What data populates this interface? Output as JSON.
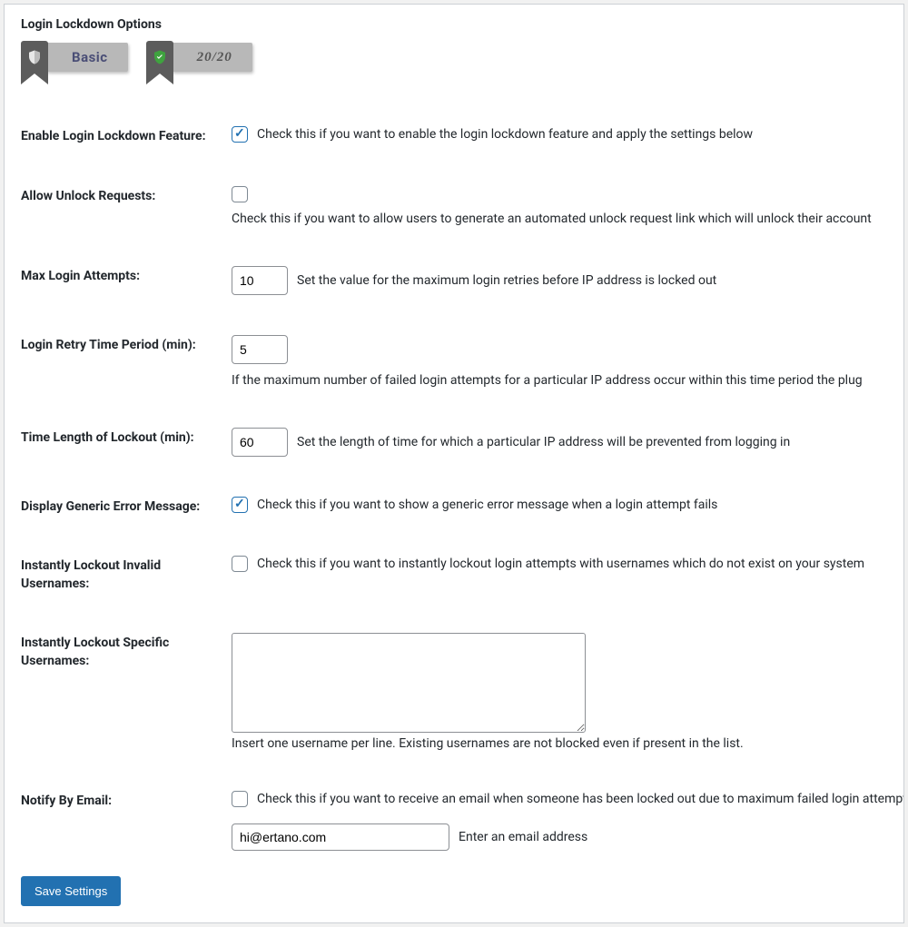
{
  "panel": {
    "title": "Login Lockdown Options"
  },
  "badges": {
    "basic_label": "Basic",
    "score_label": "20/20"
  },
  "fields": {
    "enable": {
      "label": "Enable Login Lockdown Feature:",
      "checked": true,
      "desc": "Check this if you want to enable the login lockdown feature and apply the settings below"
    },
    "allow_unlock": {
      "label": "Allow Unlock Requests:",
      "checked": false,
      "desc": "Check this if you want to allow users to generate an automated unlock request link which will unlock their account"
    },
    "max_attempts": {
      "label": "Max Login Attempts:",
      "value": "10",
      "desc": "Set the value for the maximum login retries before IP address is locked out"
    },
    "retry_period": {
      "label": "Login Retry Time Period (min):",
      "value": "5",
      "desc": "If the maximum number of failed login attempts for a particular IP address occur within this time period the plug"
    },
    "lockout_length": {
      "label": "Time Length of Lockout (min):",
      "value": "60",
      "desc": "Set the length of time for which a particular IP address will be prevented from logging in"
    },
    "generic_error": {
      "label": "Display Generic Error Message:",
      "checked": true,
      "desc": "Check this if you want to show a generic error message when a login attempt fails"
    },
    "invalid_usernames": {
      "label": "Instantly Lockout Invalid Usernames:",
      "checked": false,
      "desc": "Check this if you want to instantly lockout login attempts with usernames which do not exist on your system"
    },
    "specific_usernames": {
      "label": "Instantly Lockout Specific Usernames:",
      "value": "",
      "helper": "Insert one username per line. Existing usernames are not blocked even if present in the list."
    },
    "notify_email": {
      "label": "Notify By Email:",
      "checked": false,
      "desc": "Check this if you want to receive an email when someone has been locked out due to maximum failed login attempts",
      "email_value": "hi@ertano.com",
      "email_desc": "Enter an email address"
    }
  },
  "actions": {
    "save": "Save Settings"
  }
}
